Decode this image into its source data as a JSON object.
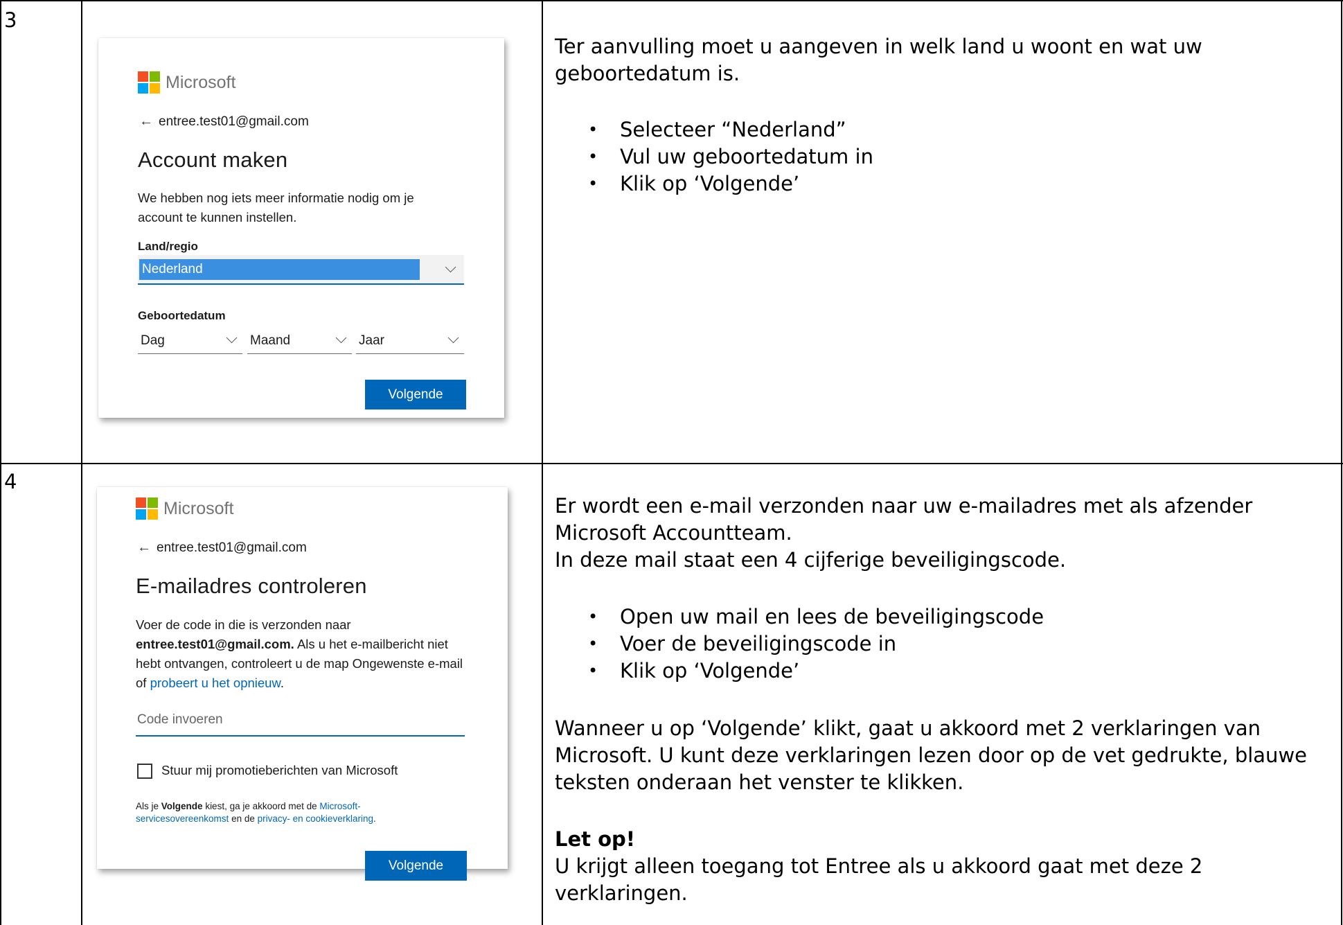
{
  "rows": [
    {
      "number": "3",
      "card": {
        "brand": "Microsoft",
        "email": "entree.test01@gmail.com",
        "title": "Account maken",
        "intro": "We hebben nog iets meer informatie nodig om je account te kunnen instellen.",
        "country_label": "Land/regio",
        "country_value": "Nederland",
        "dob_label": "Geboortedatum",
        "day_placeholder": "Dag",
        "month_placeholder": "Maand",
        "year_placeholder": "Jaar",
        "next_button": "Volgende"
      },
      "instructions": {
        "paragraph": "Ter aanvulling moet u aangeven in welk land u woont en wat uw geboortedatum is.",
        "bullets": [
          "Selecteer “Nederland”",
          "Vul uw geboortedatum in",
          "Klik op ‘Volgende’"
        ]
      }
    },
    {
      "number": "4",
      "card": {
        "brand": "Microsoft",
        "email": "entree.test01@gmail.com",
        "title": "E-mailadres controleren",
        "intro_before": "Voer de code in die is verzonden naar",
        "intro_email": "entree.test01@gmail.com.",
        "intro_middle": "Als u het e-mailbericht niet hebt ontvangen, controleert u de map Ongewenste e-mail of",
        "intro_link": "probeert u het opnieuw",
        "intro_end": ".",
        "code_placeholder": "Code invoeren",
        "promo_checkbox_label": "Stuur mij promotieberichten van Microsoft",
        "terms_prefix": "Als je",
        "terms_bold": "Volgende",
        "terms_middle": "kiest, ga je akkoord met de",
        "terms_link1": "Microsoft-servicesovereenkomst",
        "terms_and": "en de",
        "terms_link2": "privacy- en cookieverklaring",
        "terms_end": ".",
        "next_button": "Volgende"
      },
      "instructions": {
        "paragraph1": "Er wordt een e-mail verzonden naar uw e-mailadres met als afzender Microsoft Accountteam.",
        "paragraph2": "In deze mail staat een 4 cijferige beveiligingscode.",
        "bullets": [
          "Open uw mail en lees de beveiligingscode",
          "Voer de beveiligingscode in",
          "Klik op ‘Volgende’"
        ],
        "paragraph3": "Wanneer u op ‘Volgende’ klikt, gaat u akkoord met 2 verklaringen van Microsoft. U kunt deze verklaringen lezen door op de vet gedrukte, blauwe teksten onderaan het venster te klikken.",
        "warning_title": "Let op!",
        "warning_text": "U krijgt alleen toegang tot Entree als u akkoord gaat met deze 2 verklaringen."
      }
    }
  ]
}
